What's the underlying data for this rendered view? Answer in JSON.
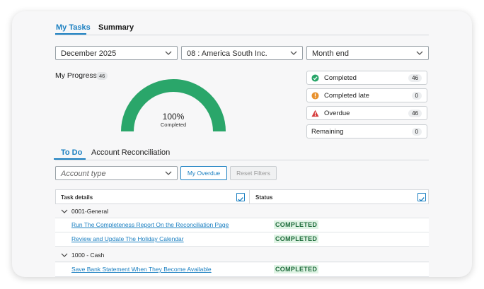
{
  "top_tabs": [
    {
      "label": "My Tasks",
      "active": true
    },
    {
      "label": "Summary",
      "active": false
    }
  ],
  "filters": {
    "period": "December 2025",
    "entity": "08 : America South Inc.",
    "cycle": "Month end"
  },
  "progress": {
    "title": "My Progress",
    "count": "46",
    "percent_label": "100%",
    "sub_label": "Completed",
    "fraction_complete": 1.0,
    "gauge_color": "#2aa66a"
  },
  "stats": [
    {
      "label": "Completed",
      "value": "46",
      "icon": "check-circle-icon",
      "color": "#2aa66a"
    },
    {
      "label": "Completed late",
      "value": "0",
      "icon": "alert-circle-icon",
      "color": "#e8912d"
    },
    {
      "label": "Overdue",
      "value": "46",
      "icon": "warning-triangle-icon",
      "color": "#d63a3a"
    },
    {
      "label": "Remaining",
      "value": "0",
      "icon": "",
      "color": ""
    }
  ],
  "sub_tabs": [
    {
      "label": "To Do",
      "active": true
    },
    {
      "label": "Account Reconciliation",
      "active": false
    }
  ],
  "toolbar": {
    "account_type_placeholder": "Account type",
    "my_overdue_label": "My Overdue",
    "reset_filters_label": "Reset Filters"
  },
  "table": {
    "col_task": "Task details",
    "col_status": "Status",
    "groups": [
      {
        "name": "0001-General",
        "tasks": [
          {
            "title": "Run The Completeness Report On the Reconciliation Page",
            "status": "COMPLETED"
          },
          {
            "title": "Review and Update The Holiday Calendar",
            "status": "COMPLETED"
          }
        ]
      },
      {
        "name": "1000 - Cash",
        "tasks": [
          {
            "title": "Save Bank Statement When They Become Available",
            "status": "COMPLETED"
          }
        ]
      }
    ]
  },
  "colors": {
    "accent": "#1a7fc1",
    "completed_badge_bg": "#dff3e4",
    "completed_badge_text": "#1d6b3a"
  }
}
